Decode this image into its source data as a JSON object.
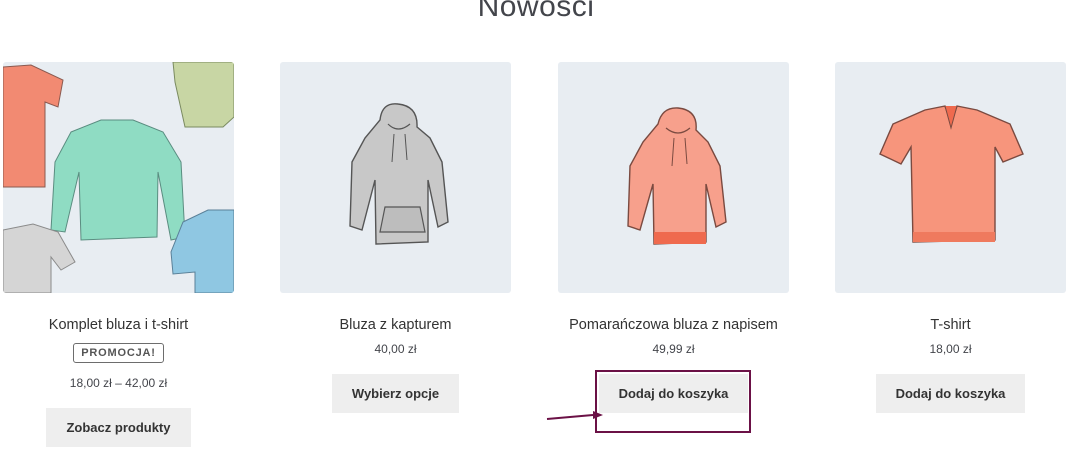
{
  "section": {
    "title": "Nowości"
  },
  "products": [
    {
      "name": "Komplet bluza i t-shirt",
      "badge": "PROMOCJA!",
      "price": "18,00 zł – 42,00 zł",
      "button": "Zobacz produkty",
      "image": "clothing-set-image"
    },
    {
      "name": "Bluza z kapturem",
      "price": "40,00 zł",
      "button": "Wybierz opcje",
      "image": "grey-hoodie-image"
    },
    {
      "name": "Pomarańczowa bluza z napisem",
      "price": "49,99 zł",
      "button": "Dodaj do koszyka",
      "image": "orange-hoodie-image"
    },
    {
      "name": "T-shirt",
      "price": "18,00 zł",
      "button": "Dodaj do koszyka",
      "image": "orange-tshirt-image"
    }
  ],
  "annotation": {
    "color": "#6b1146",
    "target": "Dodaj do koszyka"
  },
  "colors": {
    "thumb_bg": "#e8edf2",
    "button_bg": "#eeeeee"
  }
}
